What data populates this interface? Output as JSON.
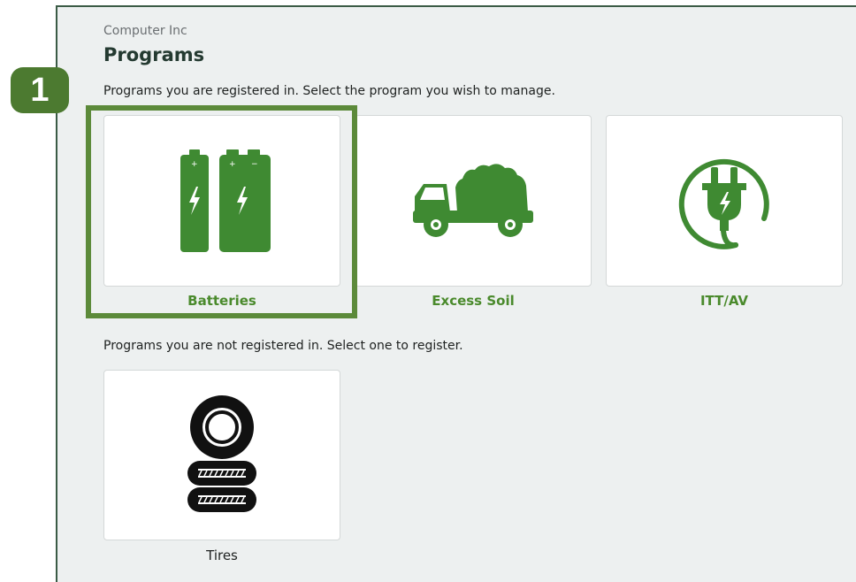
{
  "header": {
    "company": "Computer Inc",
    "title": "Programs"
  },
  "step": {
    "number": "1"
  },
  "registered": {
    "instruction": "Programs you are registered in. Select the program you wish to manage.",
    "programs": [
      {
        "label": "Batteries",
        "icon": "battery-icon"
      },
      {
        "label": "Excess Soil",
        "icon": "dump-truck-icon"
      },
      {
        "label": "ITT/AV",
        "icon": "plug-icon"
      }
    ]
  },
  "unregistered": {
    "instruction": "Programs you are not registered in. Select one to register.",
    "programs": [
      {
        "label": "Tires",
        "icon": "tires-icon"
      }
    ]
  },
  "colors": {
    "accent_green": "#3f8a32",
    "highlight_green": "#5c8a3a",
    "badge_green": "#4c7a30"
  }
}
